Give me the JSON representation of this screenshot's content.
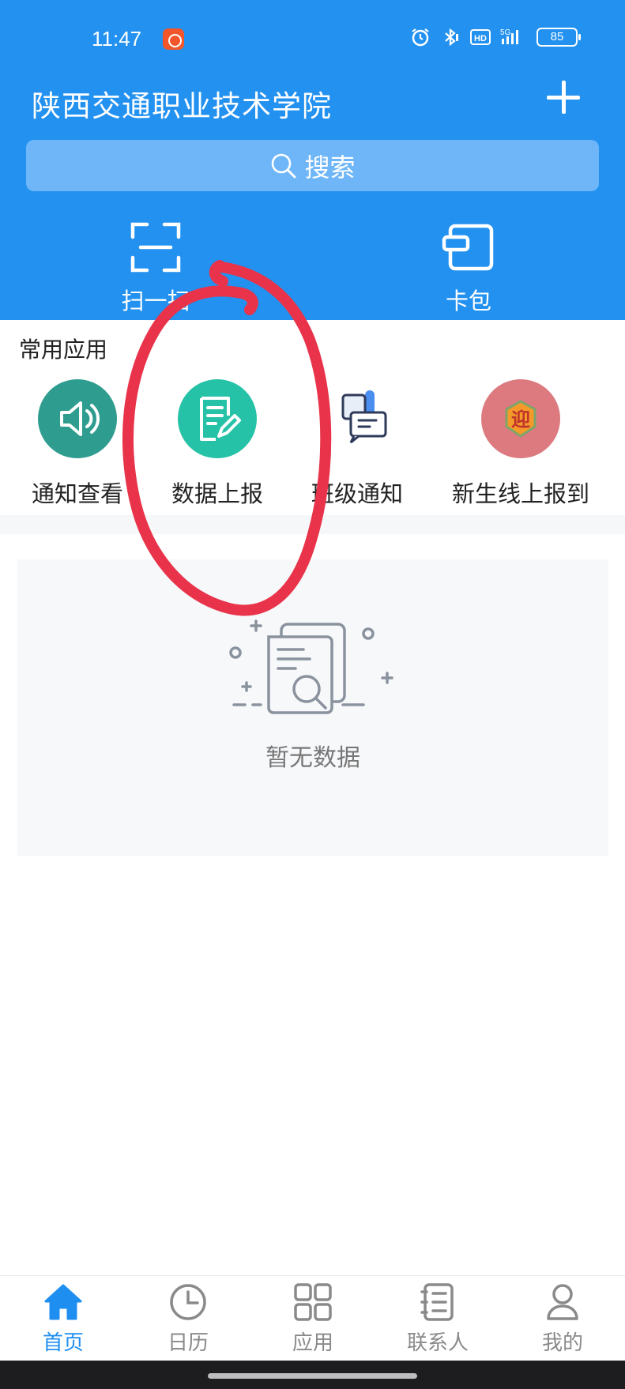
{
  "status_bar": {
    "time": "11:47",
    "battery": "85",
    "network": "5G",
    "hd": "HD"
  },
  "header": {
    "title": "陕西交通职业技术学院",
    "search_placeholder": "搜索",
    "quick_actions": [
      {
        "label": "扫一扫",
        "icon": "scan-icon"
      },
      {
        "label": "卡包",
        "icon": "card-wallet-icon"
      }
    ]
  },
  "common_apps": {
    "title": "常用应用",
    "items": [
      {
        "label": "通知查看",
        "icon": "speaker-icon",
        "color": "#2e9c8f"
      },
      {
        "label": "数据上报",
        "icon": "edit-document-icon",
        "color": "#26c2a7"
      },
      {
        "label": "班级通知",
        "icon": "class-notice-icon",
        "color": "#e8eef7"
      },
      {
        "label": "新生线上报到",
        "icon": "welcome-badge-icon",
        "color": "#dc7a80",
        "badge_text": "迎"
      }
    ]
  },
  "empty_state": {
    "text": "暂无数据"
  },
  "bottom_nav": {
    "items": [
      {
        "label": "首页",
        "icon": "home-icon",
        "active": true
      },
      {
        "label": "日历",
        "icon": "clock-icon",
        "active": false
      },
      {
        "label": "应用",
        "icon": "grid-icon",
        "active": false
      },
      {
        "label": "联系人",
        "icon": "address-book-icon",
        "active": false
      },
      {
        "label": "我的",
        "icon": "person-icon",
        "active": false
      }
    ]
  },
  "colors": {
    "header_bg": "#2291f0",
    "accent": "#1f8ef1",
    "annotation": "#e8334a"
  }
}
